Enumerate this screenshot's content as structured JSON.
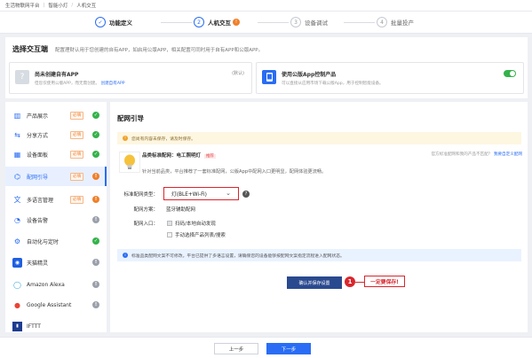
{
  "topbar": {
    "platform": "生活物联网平台",
    "product": "智能小灯",
    "page": "人机交互"
  },
  "steps": [
    {
      "num": "✓",
      "label": "功能定义"
    },
    {
      "num": "2",
      "label": "人机交互",
      "badge": "!"
    },
    {
      "num": "3",
      "label": "设备调试"
    },
    {
      "num": "4",
      "label": "批量投产"
    }
  ],
  "interaction": {
    "title": "选择交互端",
    "desc": "配置理财认用于您创建的自有APP，如启用公版APP，相关配置可同时用于自有APP和公版APP。",
    "own_app": {
      "title": "尚未创建自有APP",
      "desc": "但您仅使用公版APP，而无需创建。",
      "link": "创建自有APP",
      "tag": "(默认)"
    },
    "public_app": {
      "title": "使用公版App控制产品",
      "desc": "可以直接从应用市场下载公版App，用于控制智能设备。",
      "enabled": true
    }
  },
  "sidebar": {
    "must_label": "必填",
    "items": [
      {
        "label": "产品展示",
        "must": true,
        "status": "ok"
      },
      {
        "label": "分享方式",
        "must": true,
        "status": "ok"
      },
      {
        "label": "设备面板",
        "must": true,
        "status": "ok"
      },
      {
        "label": "配网引导",
        "must": true,
        "status": "warn",
        "active": true
      },
      {
        "label": "多语言管理",
        "must": true,
        "status": "warn"
      },
      {
        "label": "设备告警",
        "must": false,
        "status": "gray"
      },
      {
        "label": "自动化与定时",
        "must": false,
        "status": "ok"
      },
      {
        "label": "天猫精灵",
        "must": false,
        "status": "gray"
      },
      {
        "label": "Amazon Alexa",
        "must": false,
        "status": "gray"
      },
      {
        "label": "Google Assistant",
        "must": false,
        "status": "gray"
      },
      {
        "label": "IFTTT",
        "must": false,
        "status": "gray"
      }
    ]
  },
  "main": {
    "title": "配网引导",
    "notice": "您尚有内容未保存，请及时保存。",
    "product_title": "品类标准配网：电工照明灯",
    "recommend_tag": "推荐",
    "product_desc": "针对当前品类，平台推荐了一套标准配网，公版App中配网入口更明显，配网体验更流畅。",
    "right_hint": "官方标准配网和我的产品不匹配？",
    "right_link": "我要自定义配网",
    "type_label": "标准配网类型：",
    "type_value": "灯(BLE+Wi-Fi)",
    "scheme_label": "配网方案：",
    "scheme_value": "蓝牙辅助配网",
    "entry_label": "配网入口：",
    "entry_option1": "扫码/本地自动发现",
    "entry_option2": "手动选择产品列表/搜索",
    "info": "标准品类配网文案不可修改。平台已提供了多语言设置，请确保您的设备能够按配网文案指定流程进入配网状态。",
    "confirm_button": "确认并保存设置",
    "annotation_num": "1",
    "annotation_text": "一定要保存!"
  },
  "footer": {
    "prev": "上一步",
    "next": "下一步"
  }
}
